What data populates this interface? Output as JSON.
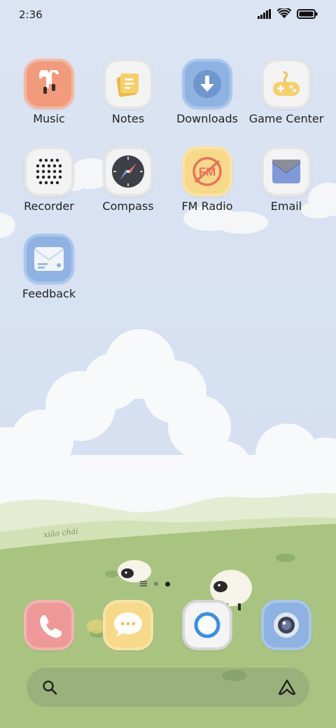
{
  "status_bar": {
    "time": "2:36",
    "signal_icon": "signal-icon",
    "wifi_icon": "wifi-icon",
    "battery_icon": "battery-icon"
  },
  "apps": [
    {
      "label": "Music",
      "icon": "earbuds-icon",
      "color": "#f19a7c"
    },
    {
      "label": "Notes",
      "icon": "notes-icon",
      "color": "#f3f3f3"
    },
    {
      "label": "Downloads",
      "icon": "download-icon",
      "color": "#8eb2e2"
    },
    {
      "label": "Game Center",
      "icon": "gamepad-icon",
      "color": "#f3f3f3"
    },
    {
      "label": "Recorder",
      "icon": "recorder-icon",
      "color": "#f3f3f3"
    },
    {
      "label": "Compass",
      "icon": "compass-icon",
      "color": "#f3f3f3"
    },
    {
      "label": "FM Radio",
      "icon": "fm-radio-icon",
      "color": "#f7d98a"
    },
    {
      "label": "Email",
      "icon": "email-icon",
      "color": "#f3f3f3"
    },
    {
      "label": "Feedback",
      "icon": "feedback-icon",
      "color": "#8eb2e2"
    }
  ],
  "wallpaper_signature": "xiǎo chái",
  "page_indicator": {
    "current": 2,
    "total": 2
  },
  "dock": [
    {
      "icon": "phone-icon",
      "color": "#ee9898"
    },
    {
      "icon": "messages-icon",
      "color": "#f7d98a"
    },
    {
      "icon": "browser-icon",
      "color": "#f4f4f4"
    },
    {
      "icon": "camera-icon",
      "color": "#8eb2e2"
    }
  ],
  "search_bar": {
    "search_icon": "search-icon",
    "assistant_icon": "assistant-icon"
  }
}
